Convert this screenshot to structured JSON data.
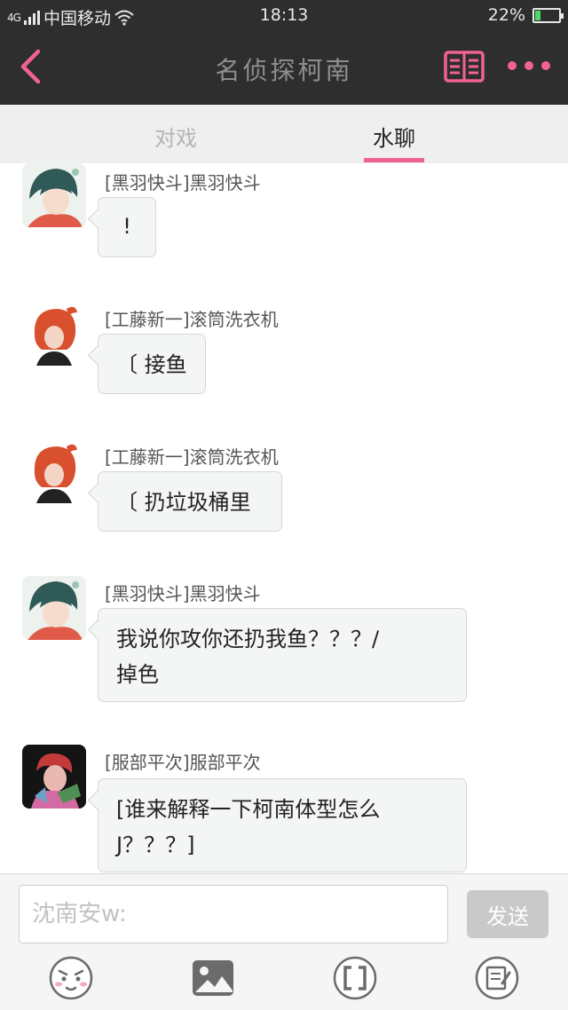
{
  "status_bar": {
    "signal": "4G",
    "carrier": "中国移动",
    "time": "18:13",
    "battery_text": "22%",
    "battery_level": 0.22
  },
  "header": {
    "title": "名侦探柯南",
    "back_icon": "back-chevron-icon",
    "book_icon": "book-icon",
    "more_icon": "more-icon"
  },
  "tabs": [
    {
      "label": "对戏",
      "active": false
    },
    {
      "label": "水聊",
      "active": true
    }
  ],
  "messages": [
    {
      "avatar": "avatar-kaito",
      "name": "[黑羽快斗]黑羽快斗",
      "text": "!"
    },
    {
      "avatar": "avatar-shinichi",
      "name": "[工藤新一]滚筒洗衣机",
      "text": "〔 接鱼"
    },
    {
      "avatar": "avatar-shinichi",
      "name": "[工藤新一]滚筒洗衣机",
      "text": "〔 扔垃圾桶里"
    },
    {
      "avatar": "avatar-kaito",
      "name": "[黑羽快斗]黑羽快斗",
      "line1": "我说你攻你还扔我鱼？？？/",
      "line2": "掉色"
    },
    {
      "avatar": "avatar-heiji",
      "name": "[服部平次]服部平次",
      "line1": "[谁来解释一下柯南体型怎么",
      "line2": "J？？？]"
    }
  ],
  "input": {
    "placeholder": "沈南安w:",
    "send_label": "发送"
  },
  "toolbar": [
    "emoji-icon",
    "image-icon",
    "bracket-icon",
    "note-icon"
  ],
  "colors": {
    "accent": "#f06292",
    "header_bg": "#2e2e2e",
    "tab_bg": "#efefef",
    "bubble_bg": "#f4f5f5"
  }
}
